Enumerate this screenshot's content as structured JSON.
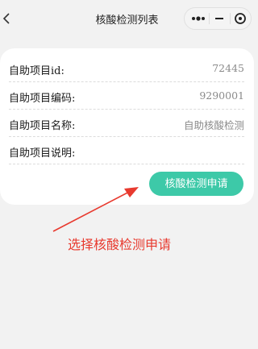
{
  "navbar": {
    "title": "核酸检测列表",
    "back_icon": "chevron-left-icon",
    "capsule_icons": [
      "more-dots-icon",
      "minimize-icon",
      "close-circle-icon"
    ]
  },
  "details": {
    "rows": [
      {
        "label": "自助项目id:",
        "value": "72445"
      },
      {
        "label": "自助项目编码:",
        "value": "9290001"
      },
      {
        "label": "自助项目名称:",
        "value": "自助核酸检测"
      },
      {
        "label": "自助项目说明:",
        "value": ""
      }
    ],
    "apply_button_label": "核酸检测申请"
  },
  "annotation": {
    "text": "选择核酸检测申请",
    "color": "#e83a2f"
  },
  "colors": {
    "accent": "#3dc9a8",
    "background": "#f2f2f2",
    "card": "#ffffff"
  }
}
